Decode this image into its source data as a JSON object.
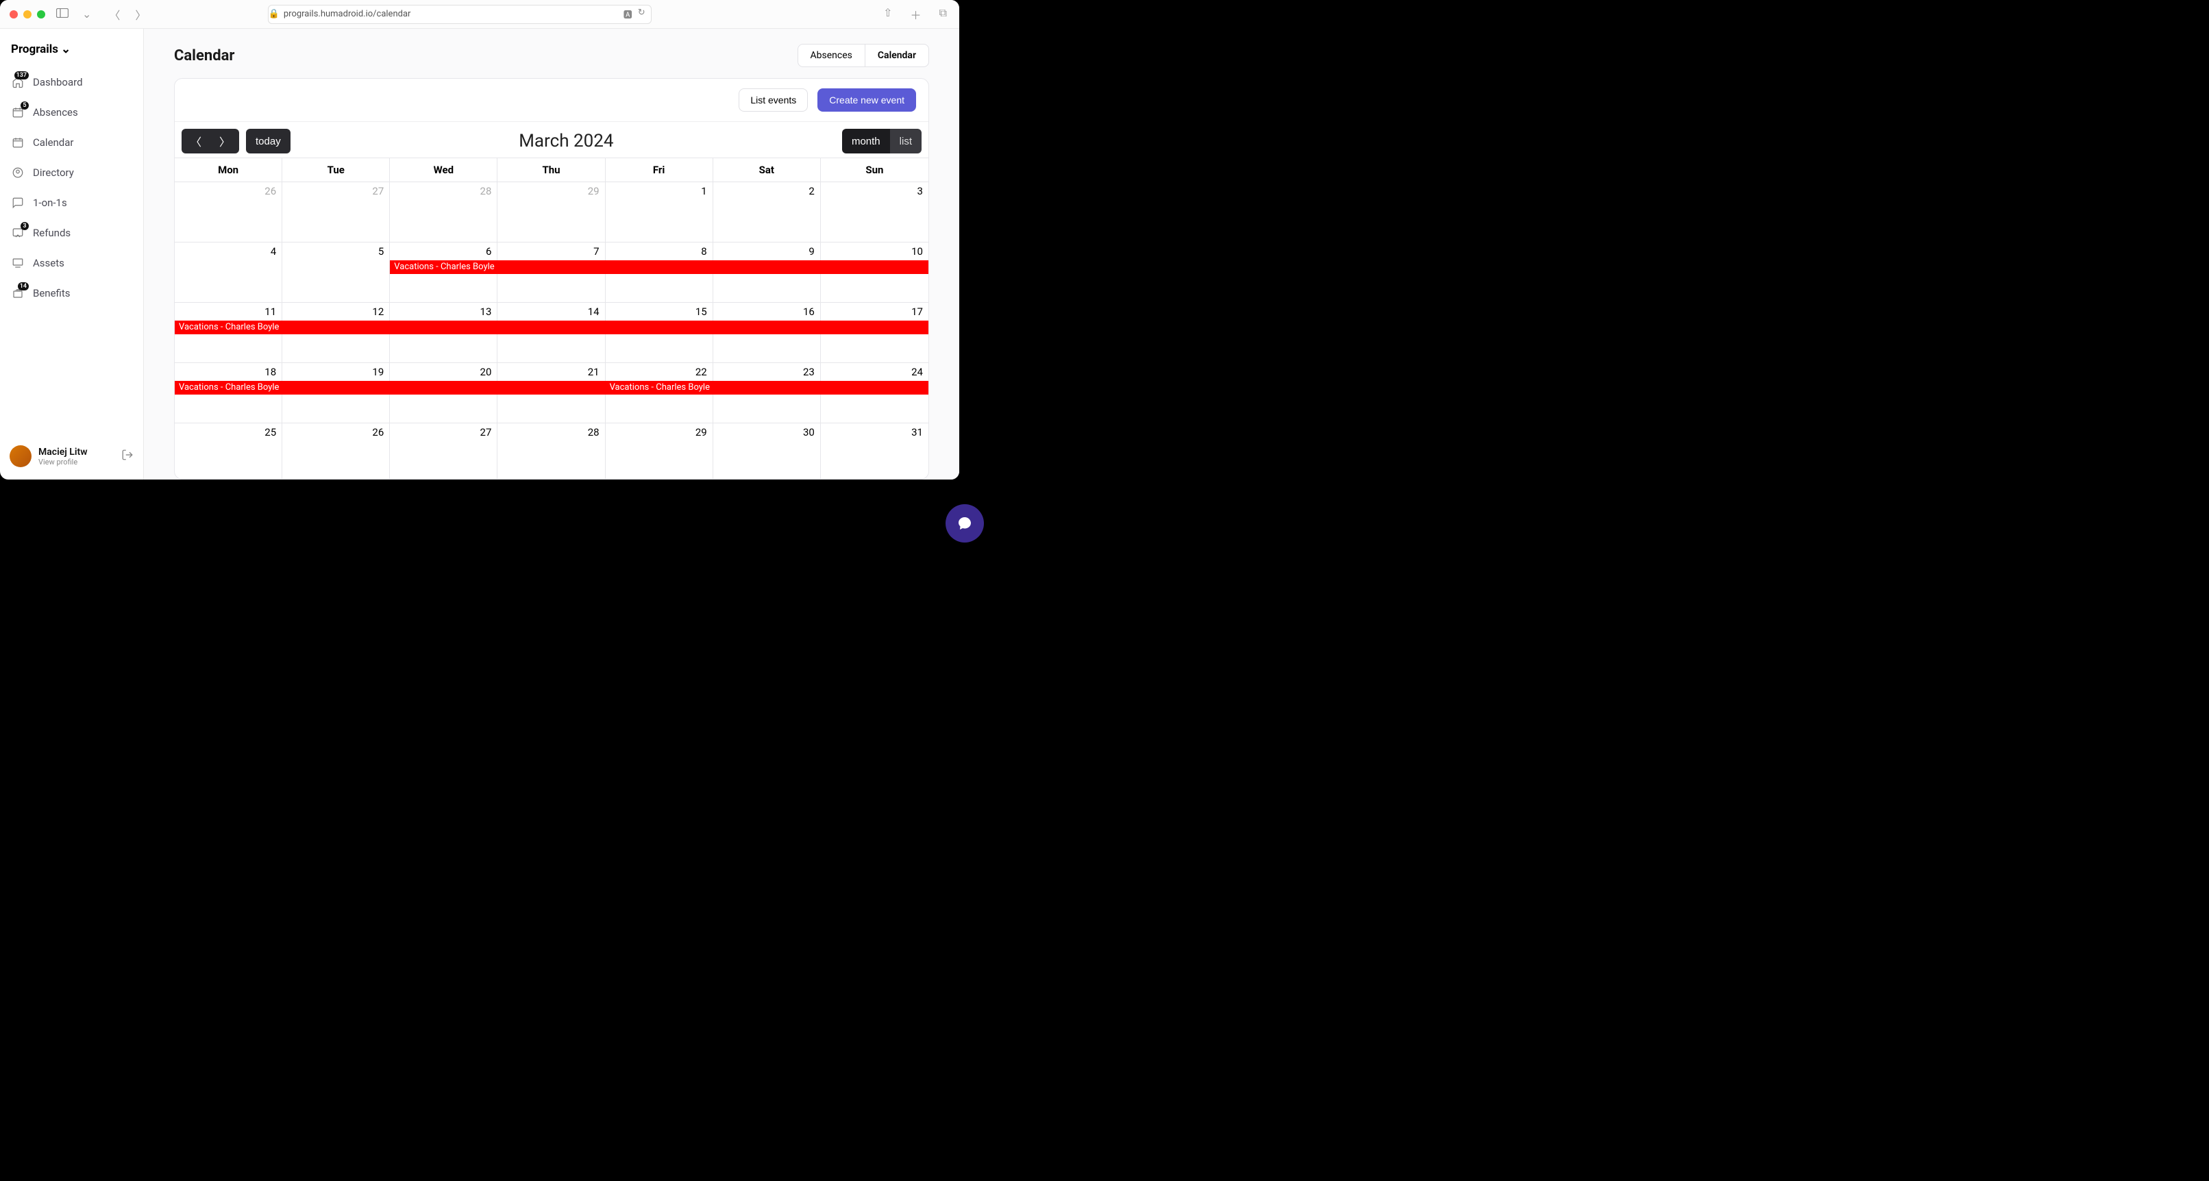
{
  "browser": {
    "url": "prograils.humadroid.io/calendar"
  },
  "sidebar": {
    "org_name": "Prograils",
    "items": [
      {
        "label": "Dashboard",
        "badge": "137"
      },
      {
        "label": "Absences",
        "badge": "5"
      },
      {
        "label": "Calendar",
        "badge": null
      },
      {
        "label": "Directory",
        "badge": null
      },
      {
        "label": "1-on-1s",
        "badge": null
      },
      {
        "label": "Refunds",
        "badge": "3"
      },
      {
        "label": "Assets",
        "badge": null
      },
      {
        "label": "Benefits",
        "badge": "14"
      }
    ],
    "user": {
      "name": "Maciej Litw",
      "sub": "View profile"
    }
  },
  "page": {
    "title": "Calendar",
    "tabs": {
      "absences": "Absences",
      "calendar": "Calendar"
    },
    "toolbar": {
      "list_events": "List events",
      "create_event": "Create new event"
    }
  },
  "calendar": {
    "today_label": "today",
    "month_label": "March 2024",
    "views": {
      "month": "month",
      "list": "list"
    },
    "dow": [
      "Mon",
      "Tue",
      "Wed",
      "Thu",
      "Fri",
      "Sat",
      "Sun"
    ],
    "weeks": [
      {
        "days": [
          {
            "n": "26",
            "out": true
          },
          {
            "n": "27",
            "out": true
          },
          {
            "n": "28",
            "out": true
          },
          {
            "n": "29",
            "out": true
          },
          {
            "n": "1"
          },
          {
            "n": "2"
          },
          {
            "n": "3"
          }
        ],
        "events": []
      },
      {
        "days": [
          {
            "n": "4"
          },
          {
            "n": "5"
          },
          {
            "n": "6"
          },
          {
            "n": "7"
          },
          {
            "n": "8"
          },
          {
            "n": "9"
          },
          {
            "n": "10"
          }
        ],
        "events": [
          {
            "start": 2,
            "end": 7,
            "label": "Vacations - Charles Boyle"
          }
        ]
      },
      {
        "days": [
          {
            "n": "11"
          },
          {
            "n": "12"
          },
          {
            "n": "13"
          },
          {
            "n": "14"
          },
          {
            "n": "15"
          },
          {
            "n": "16"
          },
          {
            "n": "17"
          }
        ],
        "events": [
          {
            "start": 0,
            "end": 7,
            "label": "Vacations - Charles Boyle"
          }
        ]
      },
      {
        "days": [
          {
            "n": "18"
          },
          {
            "n": "19"
          },
          {
            "n": "20"
          },
          {
            "n": "21"
          },
          {
            "n": "22"
          },
          {
            "n": "23"
          },
          {
            "n": "24"
          }
        ],
        "events": [
          {
            "start": 0,
            "end": 4,
            "label": "Vacations - Charles Boyle"
          },
          {
            "start": 4,
            "end": 7,
            "label": "Vacations - Charles Boyle"
          }
        ]
      },
      {
        "days": [
          {
            "n": "25"
          },
          {
            "n": "26"
          },
          {
            "n": "27"
          },
          {
            "n": "28"
          },
          {
            "n": "29"
          },
          {
            "n": "30"
          },
          {
            "n": "31"
          }
        ],
        "events": []
      }
    ]
  }
}
